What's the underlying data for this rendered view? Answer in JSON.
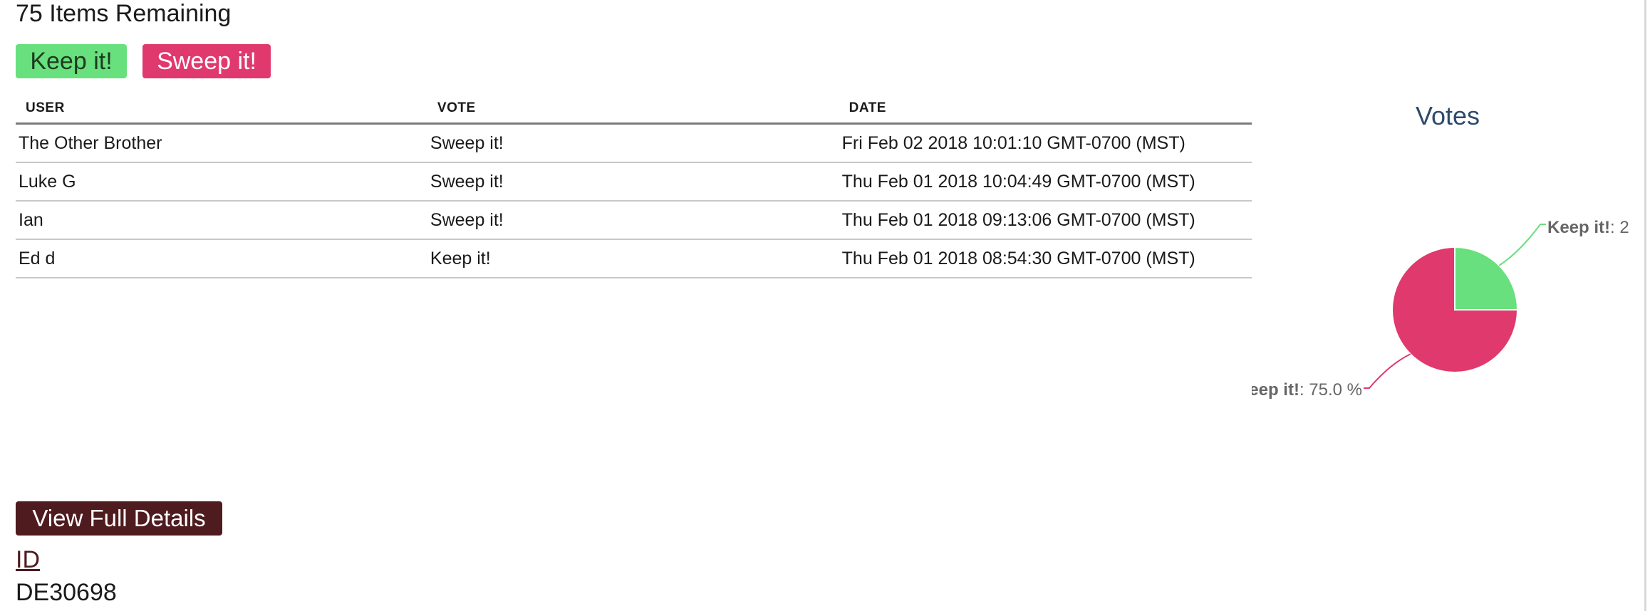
{
  "header": {
    "items_remaining": "75 Items Remaining"
  },
  "actions": {
    "keep_label": "Keep it!",
    "sweep_label": "Sweep it!"
  },
  "table": {
    "columns": [
      "USER",
      "VOTE",
      "DATE"
    ],
    "rows": [
      {
        "user": "The Other Brother",
        "vote": "Sweep it!",
        "date": "Fri Feb 02 2018 10:01:10 GMT-0700 (MST)"
      },
      {
        "user": "Luke G",
        "vote": "Sweep it!",
        "date": "Thu Feb 01 2018 10:04:49 GMT-0700 (MST)"
      },
      {
        "user": "Ian",
        "vote": "Sweep it!",
        "date": "Thu Feb 01 2018 09:13:06 GMT-0700 (MST)"
      },
      {
        "user": "Ed d",
        "vote": "Keep it!",
        "date": "Thu Feb 01 2018 08:54:30 GMT-0700 (MST)"
      }
    ]
  },
  "chart_data": {
    "type": "pie",
    "title": "Votes",
    "slices": [
      {
        "name": "Keep it!",
        "value": 25.0,
        "label_suffix": ": 2",
        "color": "#67e07d"
      },
      {
        "name": "Sweep it!",
        "value": 75.0,
        "label_suffix": ": 75.0 %",
        "color": "#e0396e"
      }
    ]
  },
  "details": {
    "button_label": "View Full Details",
    "id_label": "ID",
    "id_value": "DE30698"
  },
  "colors": {
    "keep": "#67e07d",
    "sweep": "#e0396e",
    "details_button": "#4e1b1f",
    "chart_title": "#2e4a6b",
    "chart_label": "#666666"
  }
}
